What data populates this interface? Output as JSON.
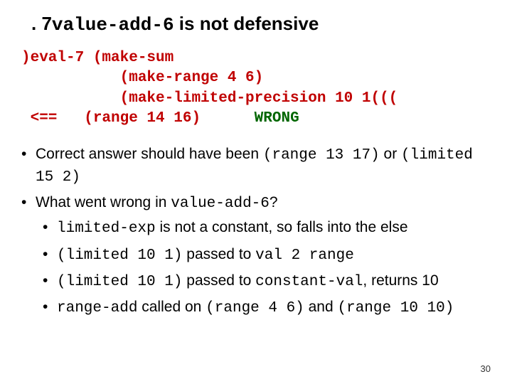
{
  "title": {
    "pre": ". 7",
    "code": "value-add-6",
    "mid": " is not defensive"
  },
  "code": {
    "line1": ")eval-7 (make-sum",
    "line2": "           (make-range 4 6)",
    "line3": "           (make-limited-precision 10 1(((",
    "line4a": " <==   (range 14 16)      ",
    "line4b": "WRONG"
  },
  "bullets": {
    "p1a": "Correct answer should have been ",
    "p1code1": "(range 13 17)",
    "p1b": " or ",
    "p1code2": "(limited 15 2)",
    "p2a": "What went wrong in ",
    "p2code": "value-add-6",
    "p2b": "?",
    "s1code": "limited-exp",
    "s1a": " is not a constant, so falls into the else",
    "s2code": "(limited 10 1)",
    "s2a": " passed to ",
    "s2code2": "val 2 range",
    "s3code": "(limited 10 1)",
    "s3a": " passed to ",
    "s3code2": "constant-val",
    "s3b": ", returns 10",
    "s4code": "range-add",
    "s4a": " called on ",
    "s4code2": "(range 4 6)",
    "s4b": " and ",
    "s4code3": "(range 10 10)"
  },
  "page_number": "30"
}
